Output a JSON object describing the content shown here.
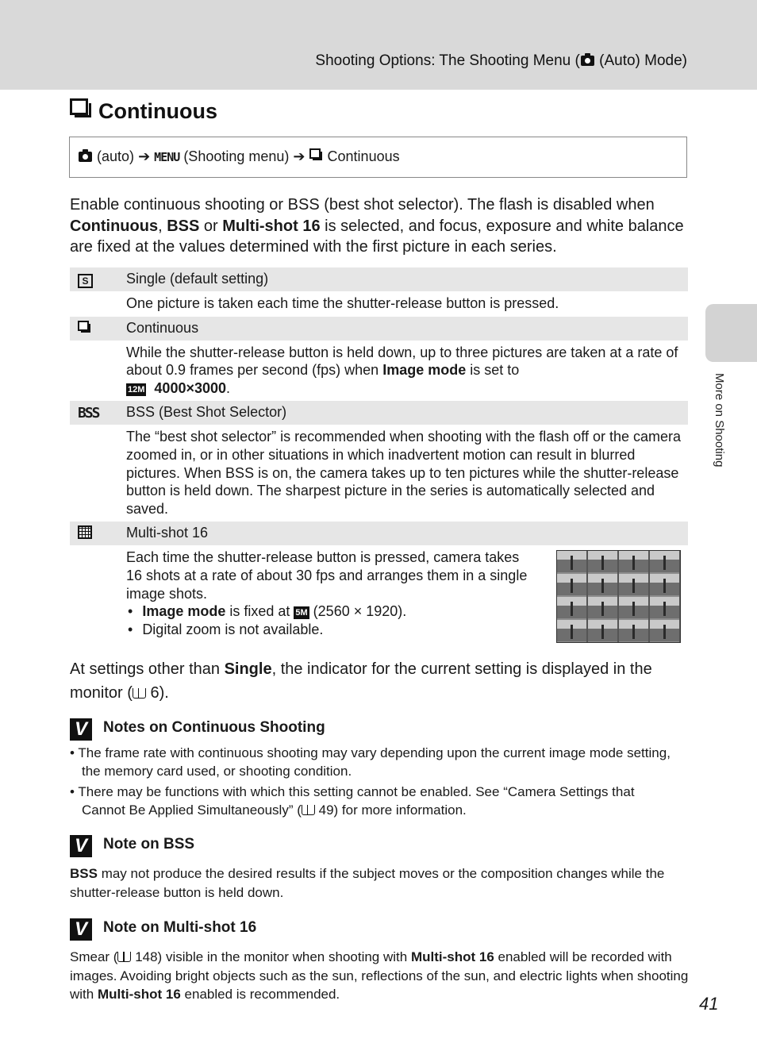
{
  "header": {
    "section_prefix": "Shooting Options: The Shooting Menu (",
    "section_suffix": " (Auto) Mode)",
    "camera_icon": "camera-icon"
  },
  "title": "Continuous",
  "nav_path": {
    "step1": "(auto)",
    "arrow": "➔",
    "menu": "MENU",
    "step2": "(Shooting menu)",
    "step3": "Continuous"
  },
  "intro": {
    "part1": "Enable continuous shooting or BSS (best shot selector). The flash is disabled when ",
    "bold1": "Continuous",
    "sep1": ", ",
    "bold2": "BSS",
    "sep2": " or ",
    "bold3": "Multi-shot 16",
    "part2": " is selected, and focus, exposure and white balance are fixed at the values determined with the first picture in each series."
  },
  "options": [
    {
      "icon": "single-icon",
      "icon_text": "S",
      "label": "Single (default setting)",
      "desc": "One picture is taken each time the shutter-release button is pressed."
    },
    {
      "icon": "continuous-icon",
      "label": "Continuous",
      "desc1": "While the shutter-release button is held down, up to three pictures are taken at a rate of about 0.9 frames per second (fps) when ",
      "desc_bold": "Image mode",
      "desc2": " is set to",
      "badge": "12M",
      "size_bold": "4000×3000",
      "desc3": "."
    },
    {
      "icon": "bss-icon",
      "icon_text": "BSS",
      "label": "BSS (Best Shot Selector)",
      "desc": "The “best shot selector” is recommended when shooting with the flash off or the camera zoomed in, or in other situations in which inadvertent motion can result in blurred pictures. When BSS is on, the camera takes up to ten pictures while the shutter-release button is held down. The sharpest picture in the series is automatically selected and saved."
    },
    {
      "icon": "multi-shot-icon",
      "label": "Multi-shot 16",
      "desc": "Each time the shutter-release button is pressed, camera takes 16 shots at a rate of about 30 fps and arranges them in a single image shots.",
      "bullet1_bold": "Image mode",
      "bullet1_text": " is fixed at ",
      "bullet1_badge": "5M",
      "bullet1_tail": " (2560 × 1920).",
      "bullet2": "Digital zoom is not available."
    }
  ],
  "other_settings": {
    "part1": "At settings other than ",
    "bold": "Single",
    "part2": ", the indicator for the current setting is displayed in the monitor (",
    "ref": " 6)."
  },
  "notes": [
    {
      "title": "Notes on Continuous Shooting",
      "items": [
        {
          "text": "The frame rate with continuous shooting may vary depending upon the current image mode setting, the memory card used, or shooting condition."
        },
        {
          "text1": "There may be functions with which this setting cannot be enabled. See “Camera Settings that Cannot Be Applied Simultaneously” (",
          "ref": " 49) for more information."
        }
      ]
    },
    {
      "title": "Note on BSS",
      "bold": "BSS",
      "text": " may not produce the desired results if the subject moves or the composition changes while the shutter-release button is held down."
    },
    {
      "title": "Note on Multi-shot 16",
      "t1": "Smear (",
      "ref": " 148) visible in the monitor when shooting with ",
      "bold1": "Multi-shot 16",
      "t2": " enabled will be recorded with images. Avoiding bright objects such as the sun, reflections of the sun, and electric lights when shooting with ",
      "bold2": "Multi-shot 16",
      "t3": " enabled is recommended."
    }
  ],
  "side_tab": "More on Shooting",
  "page_number": "41",
  "check_glyph": "V"
}
